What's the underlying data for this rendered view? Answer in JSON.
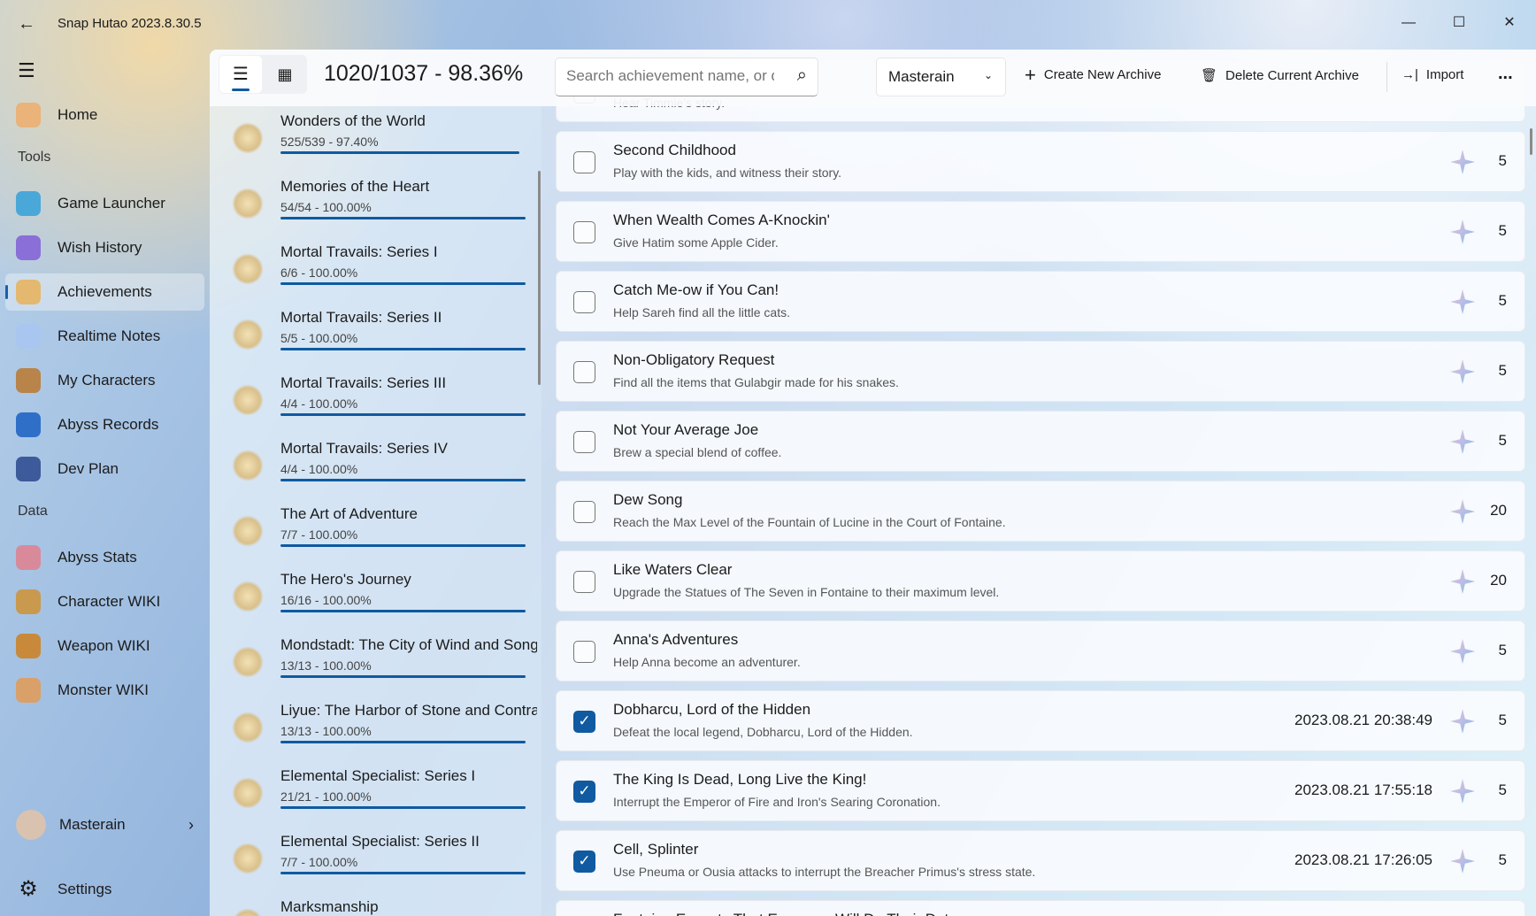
{
  "window": {
    "title": "Snap Hutao 2023.8.30.5",
    "controls": [
      "—",
      "☐",
      "✕"
    ]
  },
  "nav": {
    "items": [
      {
        "label": "Home",
        "color": "#e9b37a"
      },
      {
        "header": "Tools"
      },
      {
        "label": "Game Launcher",
        "color": "#4aa8d8"
      },
      {
        "label": "Wish History",
        "color": "#8a6fd8"
      },
      {
        "label": "Achievements",
        "color": "#e4b86f",
        "selected": true
      },
      {
        "label": "Realtime Notes",
        "color": "#a9c6f0"
      },
      {
        "label": "My Characters",
        "color": "#b8844a"
      },
      {
        "label": "Abyss Records",
        "color": "#2f6fc8"
      },
      {
        "label": "Dev Plan",
        "color": "#3d5a9a"
      },
      {
        "header": "Data"
      },
      {
        "label": "Abyss Stats",
        "color": "#d88a9a"
      },
      {
        "label": "Character WIKI",
        "color": "#c9994e"
      },
      {
        "label": "Weapon WIKI",
        "color": "#c88a3a"
      },
      {
        "label": "Monster WIKI",
        "color": "#d9a06a"
      }
    ],
    "user": "Masterain",
    "settings": "Settings"
  },
  "toolbar": {
    "stats": "1020/1037 - 98.36%",
    "search_placeholder": "Search achievement name, or description",
    "archive": "Masterain",
    "create": "Create New Archive",
    "delete": "Delete Current Archive",
    "import": "Import",
    "more": "..."
  },
  "categories": [
    {
      "title": "Wonders of the World",
      "progress": "525/539 - 97.40%",
      "fraction": 0.974
    },
    {
      "title": "Memories of the Heart",
      "progress": "54/54 - 100.00%",
      "fraction": 1
    },
    {
      "title": "Mortal Travails: Series I",
      "progress": "6/6 - 100.00%",
      "fraction": 1
    },
    {
      "title": "Mortal Travails: Series II",
      "progress": "5/5 - 100.00%",
      "fraction": 1
    },
    {
      "title": "Mortal Travails: Series III",
      "progress": "4/4 - 100.00%",
      "fraction": 1
    },
    {
      "title": "Mortal Travails: Series IV",
      "progress": "4/4 - 100.00%",
      "fraction": 1
    },
    {
      "title": "The Art of Adventure",
      "progress": "7/7 - 100.00%",
      "fraction": 1
    },
    {
      "title": "The Hero's Journey",
      "progress": "16/16 - 100.00%",
      "fraction": 1
    },
    {
      "title": "Mondstadt: The City of Wind and Song",
      "progress": "13/13 - 100.00%",
      "fraction": 1
    },
    {
      "title": "Liyue: The Harbor of Stone and Contracts",
      "progress": "13/13 - 100.00%",
      "fraction": 1
    },
    {
      "title": "Elemental Specialist: Series I",
      "progress": "21/21 - 100.00%",
      "fraction": 1
    },
    {
      "title": "Elemental Specialist: Series II",
      "progress": "7/7 - 100.00%",
      "fraction": 1
    },
    {
      "title": "Marksmanship",
      "progress": "",
      "fraction": 1
    }
  ],
  "achievements": [
    {
      "title": "",
      "desc": "Hear Timmie's story.",
      "done": false,
      "date": "",
      "points": ""
    },
    {
      "title": "Second Childhood",
      "desc": "Play with the kids, and witness their story.",
      "done": false,
      "date": "",
      "points": "5"
    },
    {
      "title": "When Wealth Comes A-Knockin'",
      "desc": "Give Hatim some Apple Cider.",
      "done": false,
      "date": "",
      "points": "5"
    },
    {
      "title": "Catch Me-ow if You Can!",
      "desc": "Help Sareh find all the little cats.",
      "done": false,
      "date": "",
      "points": "5"
    },
    {
      "title": "Non-Obligatory Request",
      "desc": "Find all the items that Gulabgir made for his snakes.",
      "done": false,
      "date": "",
      "points": "5"
    },
    {
      "title": "Not Your Average Joe",
      "desc": "Brew a special blend of coffee.",
      "done": false,
      "date": "",
      "points": "5"
    },
    {
      "title": "Dew Song",
      "desc": "Reach the Max Level of the Fountain of Lucine in the Court of Fontaine.",
      "done": false,
      "date": "",
      "points": "20"
    },
    {
      "title": "Like Waters Clear",
      "desc": "Upgrade the Statues of The Seven in Fontaine to their maximum level.",
      "done": false,
      "date": "",
      "points": "20"
    },
    {
      "title": "Anna's Adventures",
      "desc": "Help Anna become an adventurer.",
      "done": false,
      "date": "",
      "points": "5"
    },
    {
      "title": "Dobharcu, Lord of the Hidden",
      "desc": "Defeat the local legend, Dobharcu, Lord of the Hidden.",
      "done": true,
      "date": "2023.08.21 20:38:49",
      "points": "5"
    },
    {
      "title": "The King Is Dead, Long Live the King!",
      "desc": "Interrupt the Emperor of Fire and Iron's Searing Coronation.",
      "done": true,
      "date": "2023.08.21 17:55:18",
      "points": "5"
    },
    {
      "title": "Cell, Splinter",
      "desc": "Use Pneuma or Ousia attacks to interrupt the Breacher Primus's stress state.",
      "done": true,
      "date": "2023.08.21 17:26:05",
      "points": "5"
    },
    {
      "title": "Fontaine Expects That Everyone Will Do Their Duty",
      "desc": "",
      "done": false,
      "date": "",
      "points": ""
    }
  ]
}
